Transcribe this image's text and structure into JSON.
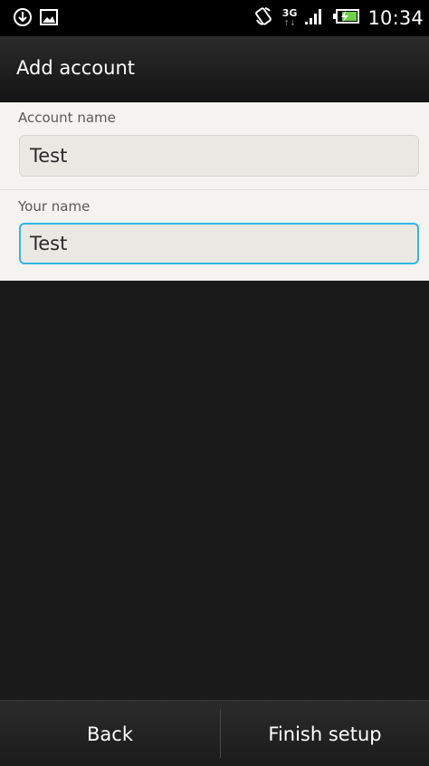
{
  "status_bar": {
    "time": "10:34",
    "network_type": "3G",
    "icons": [
      "download-icon",
      "image-icon",
      "rotate-icon",
      "signal-icon",
      "battery-icon"
    ]
  },
  "title_bar": {
    "title": "Add account"
  },
  "form": {
    "account_name": {
      "label": "Account name",
      "value": "Test"
    },
    "your_name": {
      "label": "Your name",
      "value": "Test",
      "focused": true
    }
  },
  "bottom_bar": {
    "back_label": "Back",
    "finish_label": "Finish setup"
  },
  "colors": {
    "focus_accent": "#33b5e5",
    "battery_green": "#6ed14a"
  }
}
